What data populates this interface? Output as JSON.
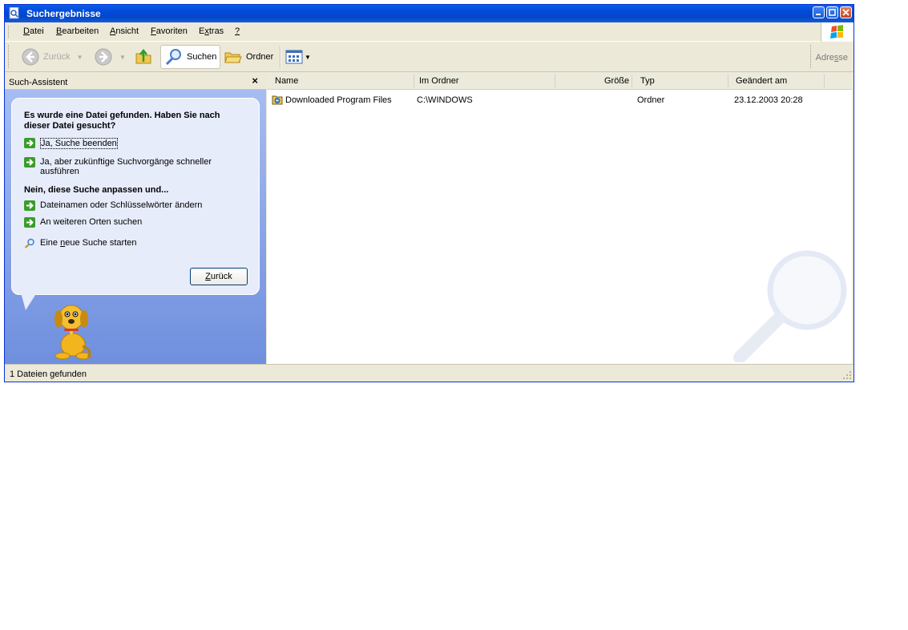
{
  "window": {
    "title": "Suchergebnisse"
  },
  "menu": [
    {
      "pre": "",
      "u": "D",
      "post": "atei"
    },
    {
      "pre": "",
      "u": "B",
      "post": "earbeiten"
    },
    {
      "pre": "",
      "u": "A",
      "post": "nsicht"
    },
    {
      "pre": "",
      "u": "F",
      "post": "avoriten"
    },
    {
      "pre": "E",
      "u": "x",
      "post": "tras"
    },
    {
      "pre": "",
      "u": "?",
      "post": ""
    }
  ],
  "toolbar": {
    "back_label": "Zurück",
    "search_label": "Suchen",
    "folders_label": "Ordner",
    "address_pre": "Adre",
    "address_u": "s",
    "address_post": "se"
  },
  "assistant": {
    "title": "Such-Assistent",
    "close": "×",
    "question": "Es wurde eine Datei gefunden. Haben Sie nach dieser Datei gesucht?",
    "option_yes_stop": "Ja, Suche beenden",
    "option_yes_faster": "Ja, aber zukünftige Suchvorgänge schneller ausführen",
    "no_heading": "Nein, diese Suche anpassen und...",
    "option_change_names": "Dateinamen oder Schlüsselwörter ändern",
    "option_other_places": "An weiteren Orten suchen",
    "new_search_pre": "Eine ",
    "new_search_u": "n",
    "new_search_post": "eue Suche starten",
    "back_button_u": "Z",
    "back_button_post": "urück"
  },
  "columns": [
    "Name",
    "Im Ordner",
    "Größe",
    "Typ",
    "Geändert am"
  ],
  "rows": [
    {
      "name": "Downloaded Program Files",
      "folder": "C:\\WINDOWS",
      "size": "",
      "type": "Ordner",
      "modified": "23.12.2003 20:28"
    }
  ],
  "status": {
    "text": "1 Dateien gefunden"
  },
  "colors": {
    "titlebar": "#0048d8",
    "panel": "#7b9ee3",
    "chrome": "#ece9d8"
  }
}
